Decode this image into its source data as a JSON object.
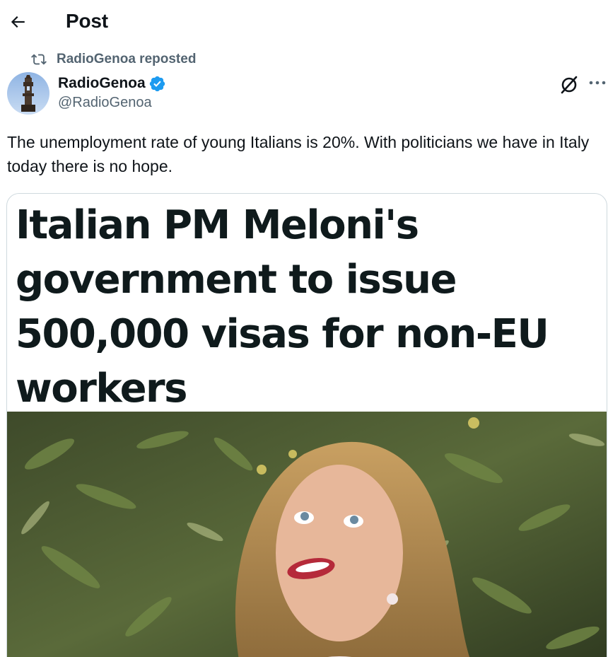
{
  "header": {
    "title": "Post",
    "back_icon": "arrow-left-icon"
  },
  "repost": {
    "text": "RadioGenoa reposted",
    "icon": "repost-icon"
  },
  "author": {
    "name": "RadioGenoa",
    "handle": "@RadioGenoa",
    "verified": true,
    "verified_color": "#1d9bf0"
  },
  "actions": {
    "grok_icon": "grok-icon",
    "more_icon": "more-icon"
  },
  "post": {
    "text": "The unemployment rate of young Italians is 20%. With politicians we have in Italy today there is no hope."
  },
  "media": {
    "headline": "Italian PM Meloni's government to issue 500,000 visas for non-EU workers"
  },
  "colors": {
    "text": "#0f1419",
    "secondary": "#536471",
    "border": "#cfd9de"
  }
}
